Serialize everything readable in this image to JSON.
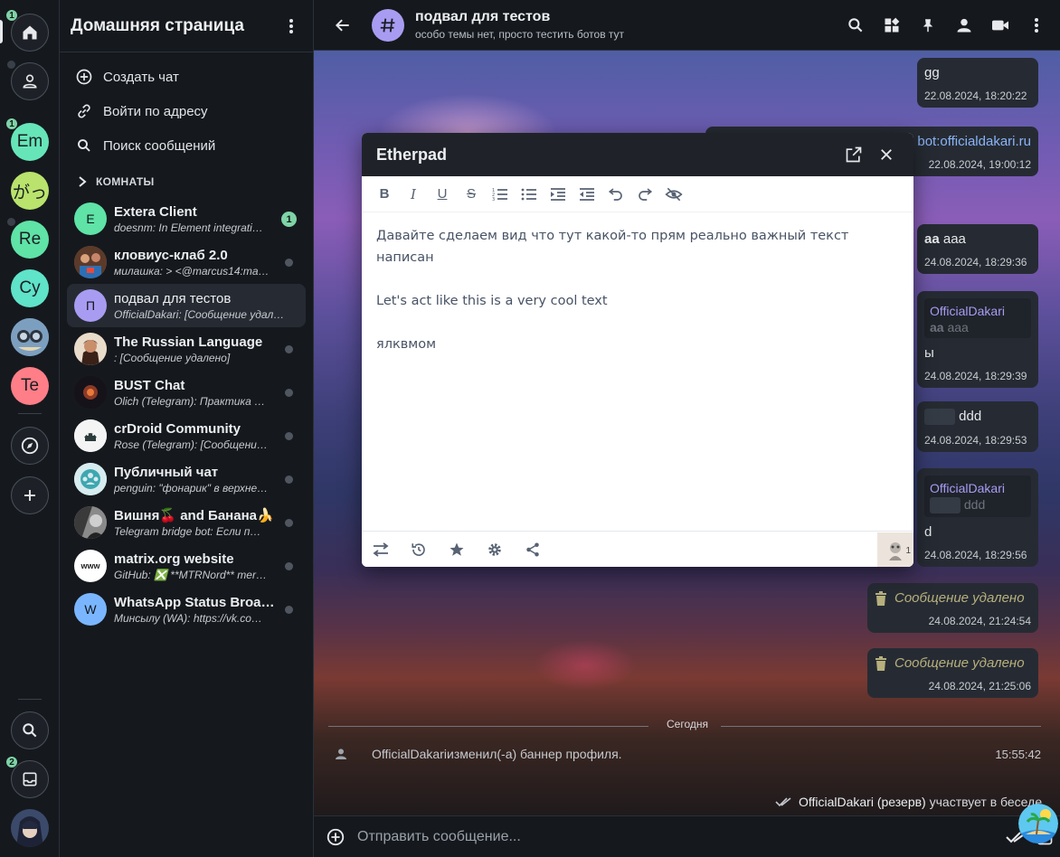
{
  "rail": {
    "badge_home": "1",
    "badge_em": "1",
    "badge_inbox": "2",
    "spaces": [
      {
        "label": "Em",
        "color": "#66e6b8"
      },
      {
        "label": "がっ",
        "color": "#b9e36c"
      },
      {
        "label": "Re",
        "color": "#5fe3a6"
      },
      {
        "label": "Cy",
        "color": "#5fe3c9"
      },
      {
        "label": "",
        "color": "#6a8fb5"
      },
      {
        "label": "Te",
        "color": "#ff7e87"
      }
    ]
  },
  "rooms_panel": {
    "title": "Домашняя страница",
    "actions": {
      "create": "Создать чат",
      "join": "Войти по адресу",
      "search": "Поиск сообщений"
    },
    "section": "КОМНАТЫ",
    "rooms": [
      {
        "name": "Extera Client",
        "preview": "doesnm: In Element integrati…",
        "avatar": "E",
        "color": "#5fe3a6",
        "badge": "1"
      },
      {
        "name": "кловиус-клаб 2.0",
        "preview": "милашка: > <@marcus14:ma…",
        "avatar": "",
        "color": "#8a5a3a"
      },
      {
        "name": "подвал для тестов",
        "preview": "OfficialDakari: [Сообщение удал…",
        "avatar": "П",
        "color": "#a89cf2"
      },
      {
        "name": "The Russian Language",
        "preview": ": [Сообщение удалено]",
        "avatar": "",
        "color": "#7a4a2a"
      },
      {
        "name": "BUST Chat",
        "preview": "Olich (Telegram): Практика …",
        "avatar": "",
        "color": "#1a1420"
      },
      {
        "name": "crDroid Community",
        "preview": "Rose (Telegram): [Сообщени…",
        "avatar": "",
        "color": "#f2f2f2"
      },
      {
        "name": "Публичный чат",
        "preview": "penguin: \"фонарик\" в верхне…",
        "avatar": "",
        "color": "#cfe8ea"
      },
      {
        "name": "Вишня🍒 and Банана🍌",
        "preview": "Telegram bridge bot: Если п…",
        "avatar": "",
        "color": "#6a6a6a"
      },
      {
        "name": "matrix.org website",
        "preview": "GitHub: ❎ **MTRNord** mer…",
        "avatar": "www",
        "color": "#ffffff"
      },
      {
        "name": "WhatsApp Status Broa…",
        "preview": "Минсылу (WA): https://vk.co…",
        "avatar": "W",
        "color": "#7ab6ff"
      }
    ]
  },
  "chat": {
    "title": "подвал для тестов",
    "topic": "особо темы нет, просто тестить ботов тут",
    "messages": {
      "m1_text": "gg",
      "m1_time": "22.08.2024, 18:20:22",
      "m2_text": "bot:officialdakari.ru",
      "m2_time": "22.08.2024, 19:00:12",
      "m3_bold": "aa",
      "m3_text": " aaa",
      "m3_time": "24.08.2024, 18:29:36",
      "m4_reply_name": "OfficialDakari",
      "m4_reply_bold": "aa",
      "m4_reply_text": " aaa",
      "m4_text": "ы",
      "m4_time": "24.08.2024, 18:29:39",
      "m5_text": "ddd",
      "m5_time": "24.08.2024, 18:29:53",
      "m6_reply_name": "OfficialDakari",
      "m6_reply_text": "ddd",
      "m6_text": "d",
      "m6_time": "24.08.2024, 18:29:56",
      "m7_text": "Сообщение удалено",
      "m7_time": "24.08.2024, 21:24:54",
      "m8_text": "Сообщение удалено",
      "m8_time": "24.08.2024, 21:25:06"
    },
    "day_separator": "Сегодня",
    "state_event": {
      "user": "OfficialDakari",
      "text": " изменил(-а) баннер профиля.",
      "time": "15:55:42"
    },
    "read_receipt": {
      "user": "OfficialDakari (резерв)",
      "text": " участвует в беседе."
    },
    "composer_placeholder": "Отправить сообщение..."
  },
  "etherpad": {
    "title": "Etherpad",
    "lines": [
      "Давайте сделаем вид что тут какой-то прям реально важный текст написан",
      "Let's act like this is a very cool text",
      "ялквмом"
    ],
    "user_count": "1"
  }
}
